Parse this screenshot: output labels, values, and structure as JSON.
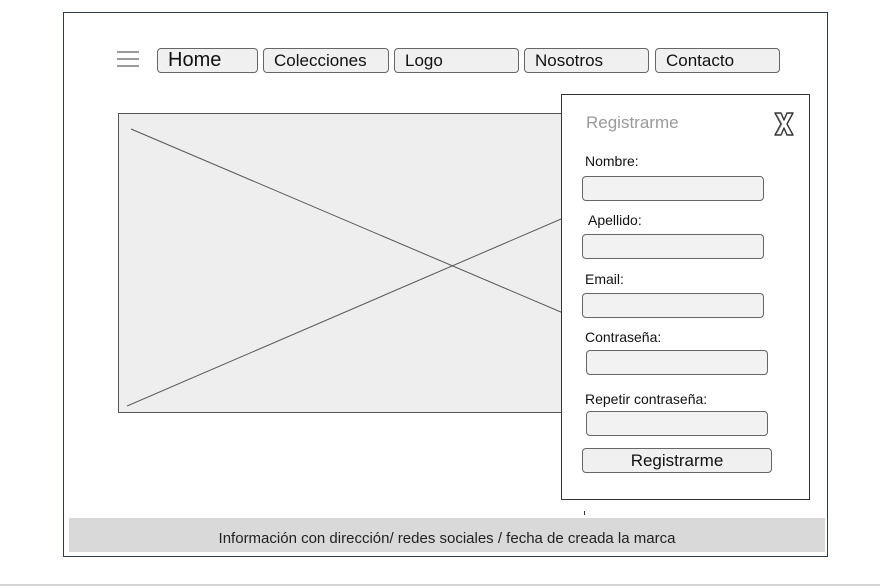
{
  "nav": {
    "menu_icon": "hamburger-menu-icon",
    "items": [
      {
        "label": "Home"
      },
      {
        "label": "Colecciones"
      },
      {
        "label": "Logo"
      },
      {
        "label": "Nosotros"
      },
      {
        "label": "Contacto"
      }
    ]
  },
  "hero": {
    "icon": "image-placeholder-icon"
  },
  "register": {
    "title": "Registrarme",
    "close_icon": "close-x-icon",
    "fields": [
      {
        "label": "Nombre:",
        "value": "",
        "placeholder": ""
      },
      {
        "label": "Apellido:",
        "value": "",
        "placeholder": ""
      },
      {
        "label": "Email:",
        "value": "",
        "placeholder": ""
      },
      {
        "label": "Contraseña:",
        "value": "",
        "placeholder": ""
      },
      {
        "label": "Repetir contraseña:",
        "value": "",
        "placeholder": ""
      }
    ],
    "submit_label": "Registrarme"
  },
  "footer": {
    "text": "Información con dirección/ redes sociales / fecha de creada la marca"
  },
  "colors": {
    "frame_border": "#2b3a55",
    "button_bg": "#f0f0f0",
    "placeholder_bg": "#eeeeee",
    "footer_bg": "#d9d9d9",
    "muted_text": "#9a9a9a"
  }
}
